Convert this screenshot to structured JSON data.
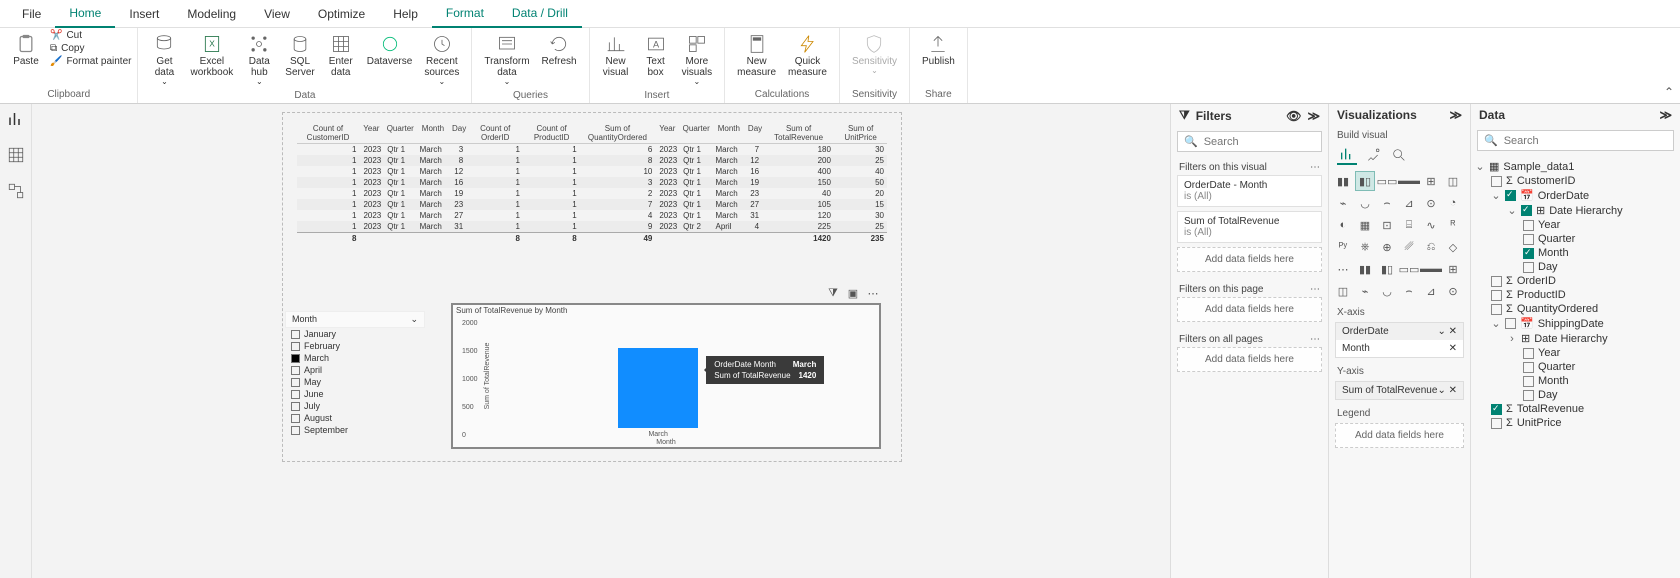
{
  "tabs": [
    "File",
    "Home",
    "Insert",
    "Modeling",
    "View",
    "Optimize",
    "Help",
    "Format",
    "Data / Drill"
  ],
  "ribbon": {
    "clipboard": {
      "group": "Clipboard",
      "paste": "Paste",
      "cut": "Cut",
      "copy": "Copy",
      "fmtpainter": "Format painter"
    },
    "data": {
      "group": "Data",
      "getdata": "Get\ndata",
      "excel": "Excel\nworkbook",
      "datahub": "Data\nhub",
      "sql": "SQL\nServer",
      "enter": "Enter\ndata",
      "dataverse": "Dataverse",
      "recent": "Recent\nsources"
    },
    "queries": {
      "group": "Queries",
      "transform": "Transform\ndata",
      "refresh": "Refresh"
    },
    "insert": {
      "group": "Insert",
      "newvis": "New\nvisual",
      "textbox": "Text\nbox",
      "morevis": "More\nvisuals"
    },
    "calc": {
      "group": "Calculations",
      "newmeas": "New\nmeasure",
      "quickmeas": "Quick\nmeasure"
    },
    "sens": {
      "group": "Sensitivity",
      "label": "Sensitivity"
    },
    "share": {
      "group": "Share",
      "publish": "Publish"
    }
  },
  "table": {
    "headers": [
      "Count of CustomerID",
      "Year",
      "Quarter",
      "Month",
      "Day",
      "Count of OrderID",
      "Count of ProductID",
      "Sum of QuantityOrdered",
      "Year",
      "Quarter",
      "Month",
      "Day",
      "Sum of TotalRevenue",
      "Sum of UnitPrice"
    ],
    "rows": [
      [
        "1",
        "2023",
        "Qtr 1",
        "March",
        "3",
        "1",
        "1",
        "6",
        "2023",
        "Qtr 1",
        "March",
        "7",
        "180",
        "30"
      ],
      [
        "1",
        "2023",
        "Qtr 1",
        "March",
        "8",
        "1",
        "1",
        "8",
        "2023",
        "Qtr 1",
        "March",
        "12",
        "200",
        "25"
      ],
      [
        "1",
        "2023",
        "Qtr 1",
        "March",
        "12",
        "1",
        "1",
        "10",
        "2023",
        "Qtr 1",
        "March",
        "16",
        "400",
        "40"
      ],
      [
        "1",
        "2023",
        "Qtr 1",
        "March",
        "16",
        "1",
        "1",
        "3",
        "2023",
        "Qtr 1",
        "March",
        "19",
        "150",
        "50"
      ],
      [
        "1",
        "2023",
        "Qtr 1",
        "March",
        "19",
        "1",
        "1",
        "2",
        "2023",
        "Qtr 1",
        "March",
        "23",
        "40",
        "20"
      ],
      [
        "1",
        "2023",
        "Qtr 1",
        "March",
        "23",
        "1",
        "1",
        "7",
        "2023",
        "Qtr 1",
        "March",
        "27",
        "105",
        "15"
      ],
      [
        "1",
        "2023",
        "Qtr 1",
        "March",
        "27",
        "1",
        "1",
        "4",
        "2023",
        "Qtr 1",
        "March",
        "31",
        "120",
        "30"
      ],
      [
        "1",
        "2023",
        "Qtr 1",
        "March",
        "31",
        "1",
        "1",
        "9",
        "2023",
        "Qtr 2",
        "April",
        "4",
        "225",
        "25"
      ]
    ],
    "total": [
      "8",
      "",
      "",
      "",
      "",
      "8",
      "8",
      "49",
      "",
      "",
      "",
      "",
      "1420",
      "235"
    ]
  },
  "slicer": {
    "title": "Month",
    "items": [
      {
        "label": "January",
        "checked": false
      },
      {
        "label": "February",
        "checked": false
      },
      {
        "label": "March",
        "checked": true
      },
      {
        "label": "April",
        "checked": false
      },
      {
        "label": "May",
        "checked": false
      },
      {
        "label": "June",
        "checked": false
      },
      {
        "label": "July",
        "checked": false
      },
      {
        "label": "August",
        "checked": false
      },
      {
        "label": "September",
        "checked": false
      }
    ]
  },
  "chart_data": {
    "type": "bar",
    "title": "Sum of TotalRevenue by Month",
    "ylabel": "Sum of TotalRevenue",
    "xlabel": "Month",
    "yticks": [
      2000,
      1500,
      1000,
      500,
      0
    ],
    "ylim": [
      0,
      2000
    ],
    "categories": [
      "March"
    ],
    "values": [
      1420
    ],
    "tooltip": {
      "k1": "OrderDate Month",
      "v1": "March",
      "k2": "Sum of TotalRevenue",
      "v2": "1420"
    }
  },
  "filters": {
    "title": "Filters",
    "search_ph": "Search",
    "sec_visual": "Filters on this visual",
    "card1_title": "OrderDate - Month",
    "card1_sub": "is (All)",
    "card2_title": "Sum of TotalRevenue",
    "card2_sub": "is (All)",
    "sec_page": "Filters on this page",
    "sec_all": "Filters on all pages",
    "drop": "Add data fields here"
  },
  "viz": {
    "title": "Visualizations",
    "build": "Build visual",
    "xaxis": "X-axis",
    "yaxis": "Y-axis",
    "legend": "Legend",
    "xwell_head": "OrderDate",
    "xwell_item": "Month",
    "ywell_head": "Sum of TotalRevenue",
    "drop": "Add data fields here"
  },
  "datapane": {
    "title": "Data",
    "search_ph": "Search",
    "table": "Sample_data1",
    "fields": {
      "CustomerID": "CustomerID",
      "OrderDate": "OrderDate",
      "DateHierarchy": "Date Hierarchy",
      "Year": "Year",
      "Quarter": "Quarter",
      "Month": "Month",
      "Day": "Day",
      "OrderID": "OrderID",
      "ProductID": "ProductID",
      "QuantityOrdered": "QuantityOrdered",
      "ShippingDate": "ShippingDate",
      "TotalRevenue": "TotalRevenue",
      "UnitPrice": "UnitPrice"
    }
  }
}
